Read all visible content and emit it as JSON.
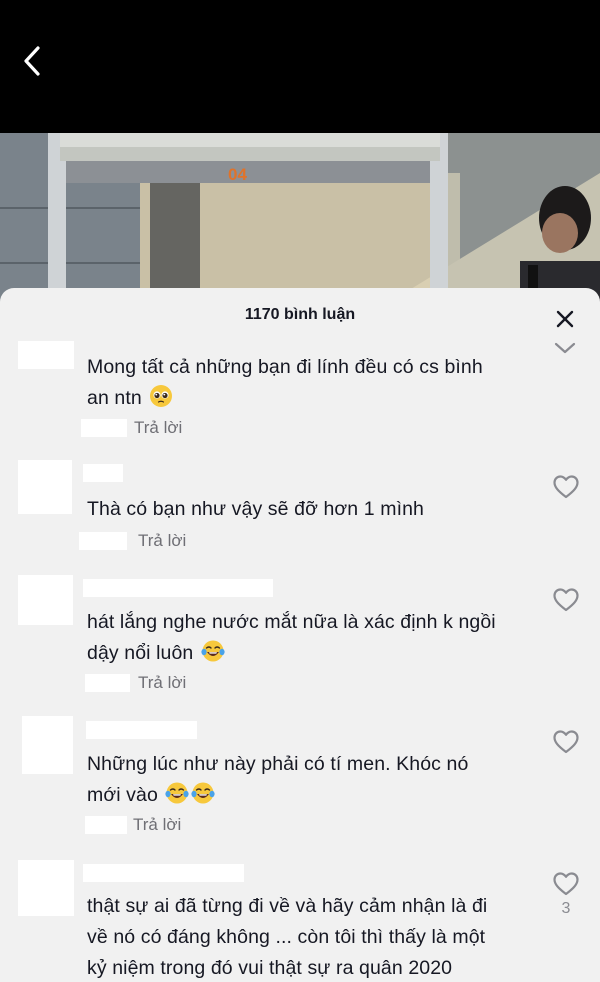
{
  "header": {
    "back_icon": "chevron-left-icon"
  },
  "video": {
    "bed_number": "04"
  },
  "comments_panel": {
    "title": "1170 bình luận",
    "close_icon": "close-x-icon",
    "collapse_icon": "chevron-down-icon"
  },
  "comments": [
    {
      "text_line1": "Mong tất cả những bạn đi lính đều có cs bình",
      "text_line2": "an ntn",
      "emoji": "pleading-face-icon",
      "reply": "Trả lời"
    },
    {
      "text_line1": "Thà có bạn như vậy sẽ đỡ hơn 1 mình",
      "reply": "Trả lời",
      "like_icon": "heart-outline-icon"
    },
    {
      "text_line1": "hát lắng nghe nước mắt nữa là xác định k ngồi",
      "text_line2": "dậy nổi luôn",
      "emoji": "tears-of-joy-icon",
      "reply": "Trả lời",
      "like_icon": "heart-outline-icon"
    },
    {
      "text_line1": "Những lúc như này phải có tí men. Khóc nó",
      "text_line2": "mới vào",
      "emoji": "tears-of-joy-icon",
      "reply": "Trả lời",
      "like_icon": "heart-outline-icon"
    },
    {
      "text_line1": "thật sự ai đã từng đi về và hãy cảm nhận là đi",
      "text_line2": "về nó có đáng không ... còn tôi thì thấy là một",
      "text_line3": "kỷ niệm trong đó vui thật sự ra quân 2020",
      "like_icon": "heart-outline-icon",
      "like_count": "3"
    }
  ]
}
